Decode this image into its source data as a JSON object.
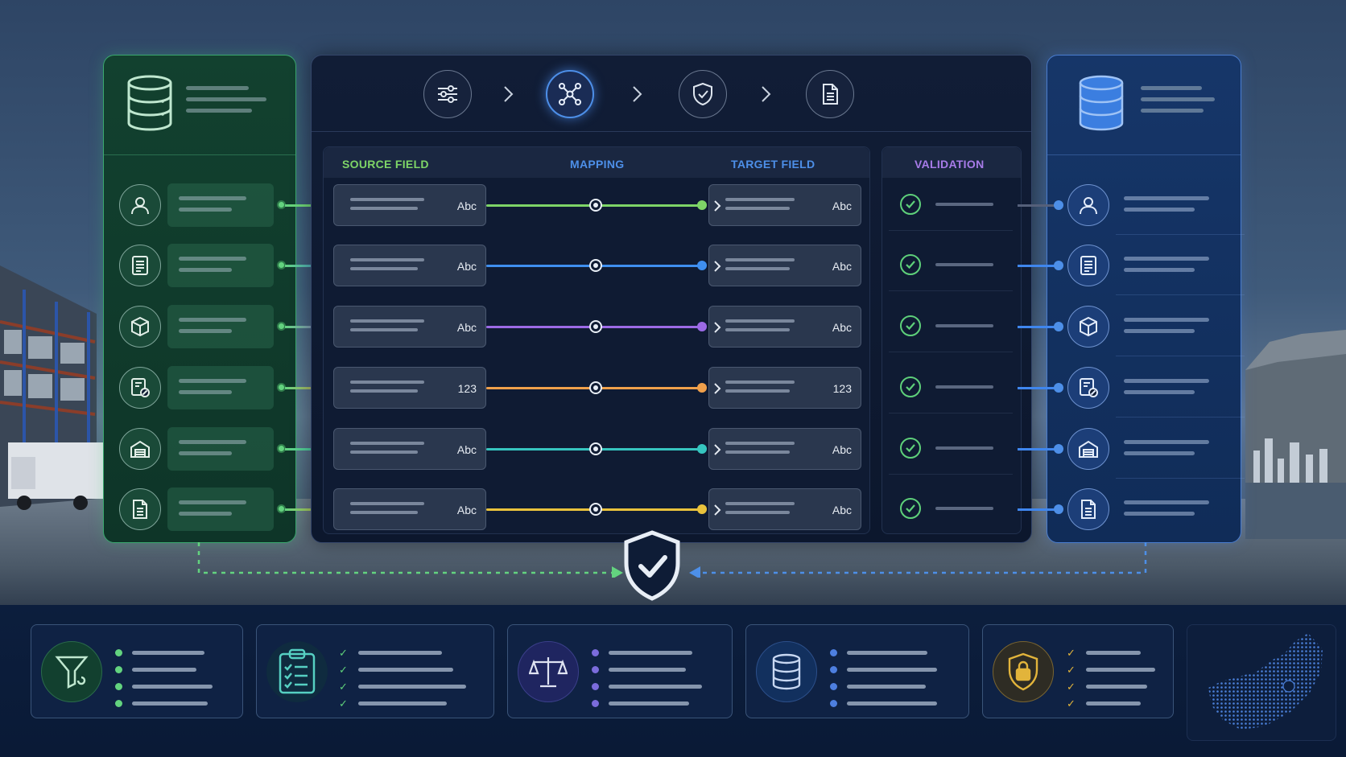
{
  "colors": {
    "source_green": "#63d37f",
    "target_blue": "#4d8fe8",
    "validation_purple": "#a77be8",
    "number_orange": "#f0a04b",
    "teal": "#3cc7c0",
    "yellow": "#e9c23c"
  },
  "steps": [
    {
      "icon": "sliders-icon",
      "active": false
    },
    {
      "icon": "network-nodes-icon",
      "active": true
    },
    {
      "icon": "shield-check-icon",
      "active": false
    },
    {
      "icon": "document-icon",
      "active": false
    }
  ],
  "table": {
    "source_field": "SOURCE FIELD",
    "mapping": "MAPPING",
    "target_field": "TARGET FIELD",
    "validation": "VALIDATION"
  },
  "rows": [
    {
      "icon": "user-icon",
      "source_type": "Abc",
      "target_type": "Abc",
      "color": "#7ed567"
    },
    {
      "icon": "list-document-icon",
      "source_type": "Abc",
      "target_type": "Abc",
      "color": "#3f8ff0"
    },
    {
      "icon": "box-icon",
      "source_type": "Abc",
      "target_type": "Abc",
      "color": "#9c6ae6"
    },
    {
      "icon": "invoice-percent-icon",
      "source_type": "123",
      "target_type": "123",
      "color": "#f0a04b"
    },
    {
      "icon": "warehouse-icon",
      "source_type": "Abc",
      "target_type": "Abc",
      "color": "#36c5bf"
    },
    {
      "icon": "file-icon",
      "source_type": "Abc",
      "target_type": "Abc",
      "color": "#e9c23c"
    }
  ],
  "bottom_cards": [
    {
      "icon": "filter-icon",
      "marker": "dot",
      "color": "#63d37f"
    },
    {
      "icon": "checklist-clipboard-icon",
      "marker": "tick",
      "color": "#5ed07a"
    },
    {
      "icon": "scales-icon",
      "marker": "dot",
      "color": "#7b6cdc"
    },
    {
      "icon": "database-icon",
      "marker": "dot",
      "color": "#4d7fe0"
    },
    {
      "icon": "lock-shield-icon",
      "marker": "tick",
      "color": "#e2b43b"
    }
  ]
}
